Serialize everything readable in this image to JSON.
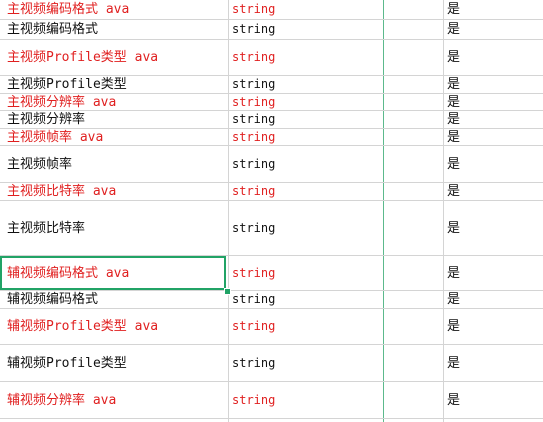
{
  "sheet": {
    "colors": {
      "red_text": "#e02020",
      "grid": "#d4d4d4",
      "selection": "#21a366"
    },
    "rows": [
      {
        "name": "主视频编码格式 ava",
        "type": "string",
        "required": "是",
        "style": "red"
      },
      {
        "name": "主视频编码格式",
        "type": "string",
        "required": "是",
        "style": "black"
      },
      {
        "name": "主视频Profile类型 ava",
        "type": "string",
        "required": "是",
        "style": "red"
      },
      {
        "name": "主视频Profile类型",
        "type": "string",
        "required": "是",
        "style": "black"
      },
      {
        "name": "主视频分辨率 ava",
        "type": "string",
        "required": "是",
        "style": "red"
      },
      {
        "name": "主视频分辨率",
        "type": "string",
        "required": "是",
        "style": "black"
      },
      {
        "name": "主视频帧率 ava",
        "type": "string",
        "required": "是",
        "style": "red"
      },
      {
        "name": "主视频帧率",
        "type": "string",
        "required": "是",
        "style": "black"
      },
      {
        "name": "主视频比特率 ava",
        "type": "string",
        "required": "是",
        "style": "red"
      },
      {
        "name": "主视频比特率",
        "type": "string",
        "required": "是",
        "style": "black"
      },
      {
        "name": "辅视频编码格式 ava",
        "type": "string",
        "required": "是",
        "style": "red",
        "selected": true
      },
      {
        "name": "辅视频编码格式",
        "type": "string",
        "required": "是",
        "style": "black"
      },
      {
        "name": "辅视频Profile类型 ava",
        "type": "string",
        "required": "是",
        "style": "red"
      },
      {
        "name": "辅视频Profile类型",
        "type": "string",
        "required": "是",
        "style": "black"
      },
      {
        "name": "辅视频分辨率 ava",
        "type": "string",
        "required": "是",
        "style": "red"
      }
    ]
  }
}
